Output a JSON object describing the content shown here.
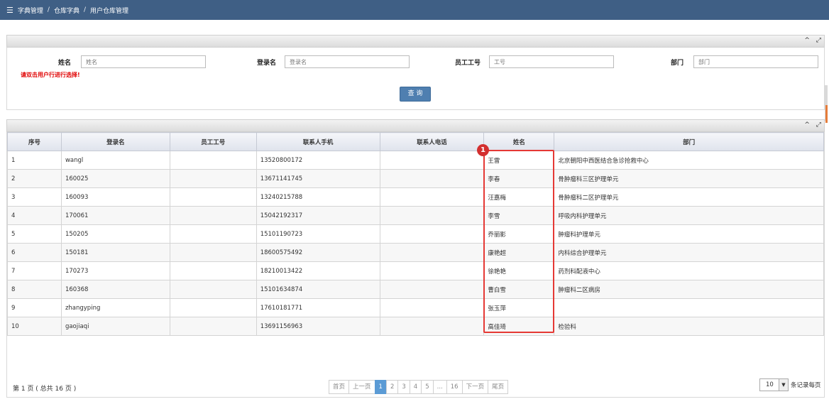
{
  "breadcrumb": {
    "menu_icon": "hamburger-icon",
    "items": [
      "字典管理",
      "仓库字典",
      "用户仓库管理"
    ],
    "separator": "/"
  },
  "search": {
    "fields": [
      {
        "label": "姓名",
        "placeholder": "姓名"
      },
      {
        "label": "登录名",
        "placeholder": "登录名"
      },
      {
        "label": "员工工号",
        "placeholder": "工号"
      },
      {
        "label": "部门",
        "placeholder": "部门"
      }
    ],
    "hint": "请双击用户行进行选择!",
    "button": "查 询"
  },
  "panel_tools": {
    "collapse": "^",
    "expand": "⤢"
  },
  "table": {
    "columns": [
      "序号",
      "登录名",
      "员工工号",
      "联系人手机",
      "联系人电话",
      "姓名",
      "部门"
    ],
    "rows": [
      {
        "no": "1",
        "login": "wangl",
        "emp": "",
        "mobile": "13520800172",
        "phone": "",
        "name": "王雷",
        "dept": "北京朝阳中西医结合急诊抢救中心"
      },
      {
        "no": "2",
        "login": "160025",
        "emp": "",
        "mobile": "13671141745",
        "phone": "",
        "name": "李春",
        "dept": "骨肿瘤科三区护理单元"
      },
      {
        "no": "3",
        "login": "160093",
        "emp": "",
        "mobile": "13240215788",
        "phone": "",
        "name": "汪嘉梅",
        "dept": "骨肿瘤科二区护理单元"
      },
      {
        "no": "4",
        "login": "170061",
        "emp": "",
        "mobile": "15042192317",
        "phone": "",
        "name": "李雪",
        "dept": "呼吸内科护理单元"
      },
      {
        "no": "5",
        "login": "150205",
        "emp": "",
        "mobile": "15101190723",
        "phone": "",
        "name": "乔丽影",
        "dept": "肿瘤科护理单元"
      },
      {
        "no": "6",
        "login": "150181",
        "emp": "",
        "mobile": "18600575492",
        "phone": "",
        "name": "康艳超",
        "dept": "内科综合护理单元"
      },
      {
        "no": "7",
        "login": "170273",
        "emp": "",
        "mobile": "18210013422",
        "phone": "",
        "name": "徐艳艳",
        "dept": "药剂科配液中心"
      },
      {
        "no": "8",
        "login": "160368",
        "emp": "",
        "mobile": "15101634874",
        "phone": "",
        "name": "曹白雪",
        "dept": "肿瘤科二区病房"
      },
      {
        "no": "9",
        "login": "zhangyping",
        "emp": "",
        "mobile": "17610181771",
        "phone": "",
        "name": "张玉萍",
        "dept": ""
      },
      {
        "no": "10",
        "login": "gaojiaqi",
        "emp": "",
        "mobile": "13691156963",
        "phone": "",
        "name": "高佳琦",
        "dept": "检验科"
      }
    ]
  },
  "annotation": {
    "badge": "1",
    "color": "#e53935"
  },
  "pagination": {
    "info": "第 1 页 ( 总共 16 页 )",
    "pages": [
      "首页",
      "上一页",
      "1",
      "2",
      "3",
      "4",
      "5",
      "...",
      "16",
      "下一页",
      "尾页"
    ],
    "active": "1",
    "page_size": "10",
    "page_size_label": "条记录每页"
  }
}
